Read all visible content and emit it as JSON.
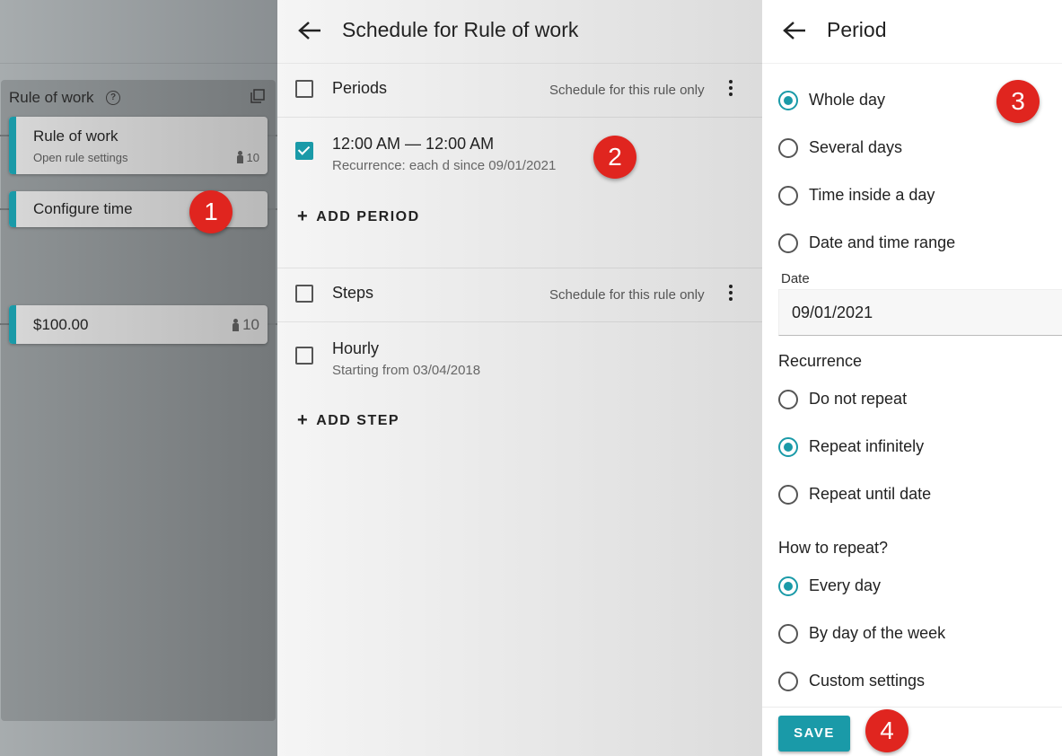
{
  "left_panel": {
    "rule_title": "Rule of work",
    "nodes": [
      {
        "title": "Rule of work",
        "subtitle": "Open rule settings",
        "count": "10"
      },
      {
        "title": "Configure time"
      },
      {
        "title": "$100.00",
        "count": "10"
      }
    ]
  },
  "schedule_panel": {
    "title": "Schedule for Rule of work",
    "periods": {
      "label": "Periods",
      "scope": "Schedule for this rule only",
      "items": [
        {
          "main": "12:00 AM — 12:00 AM",
          "sub": "Recurrence: each d since 09/01/2021",
          "checked": true
        }
      ],
      "add_label": "ADD PERIOD"
    },
    "steps": {
      "label": "Steps",
      "scope": "Schedule for this rule only",
      "items": [
        {
          "main": "Hourly",
          "sub": "Starting from 03/04/2018",
          "checked": false
        }
      ],
      "add_label": "ADD STEP"
    }
  },
  "period_panel": {
    "title": "Period",
    "period_options": [
      {
        "label": "Whole day",
        "selected": true
      },
      {
        "label": "Several days",
        "selected": false
      },
      {
        "label": "Time inside a day",
        "selected": false
      },
      {
        "label": "Date and time range",
        "selected": false
      }
    ],
    "date_label": "Date",
    "date_value": "09/01/2021",
    "recurrence_title": "Recurrence",
    "recurrence_options": [
      {
        "label": "Do not repeat",
        "selected": false
      },
      {
        "label": "Repeat infinitely",
        "selected": true
      },
      {
        "label": "Repeat until date",
        "selected": false
      }
    ],
    "how_title": "How to repeat?",
    "how_options": [
      {
        "label": "Every day",
        "selected": true
      },
      {
        "label": "By day of the week",
        "selected": false
      },
      {
        "label": "Custom settings",
        "selected": false
      }
    ],
    "save_label": "SAVE"
  },
  "badges": [
    "1",
    "2",
    "3",
    "4"
  ],
  "colors": {
    "accent": "#1a9aa8",
    "badge": "#e0251f"
  }
}
